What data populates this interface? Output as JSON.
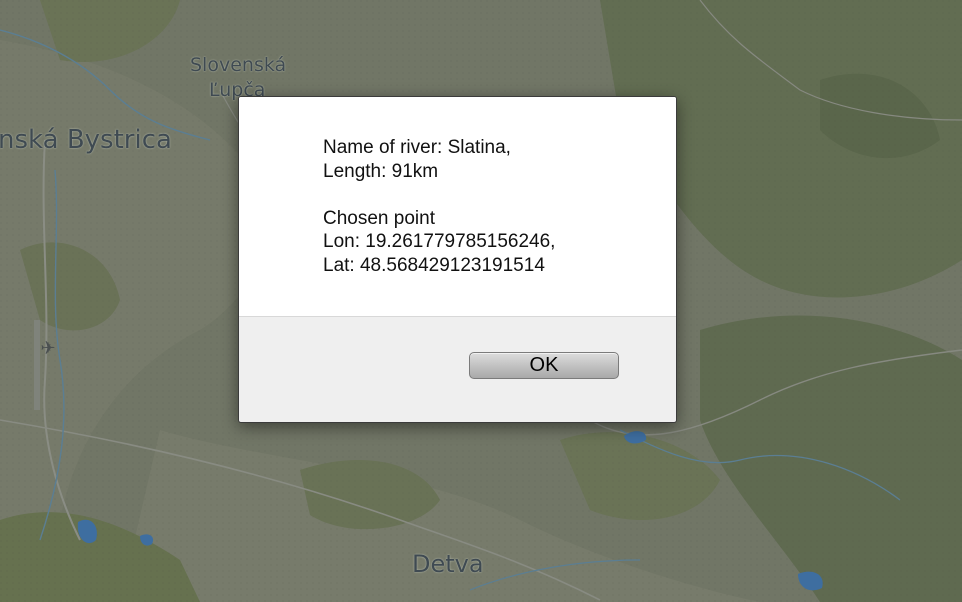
{
  "map": {
    "cities": [
      {
        "name": "nská Bystrica"
      },
      {
        "name": "Slovenská"
      },
      {
        "name": "Ľupča"
      },
      {
        "name": "Detva"
      }
    ],
    "airport_icon": "airplane-icon"
  },
  "dialog": {
    "message": {
      "river_name": "Name of river: Slatina,",
      "river_length": "Length: 91km",
      "point_title": "Chosen point",
      "lon": "Lon: 19.261779785156246,",
      "lat": "Lat: 48.568429123191514"
    },
    "ok_label": "OK"
  },
  "colors": {
    "map_base": "#6f7464",
    "forest": "#5e6c4e",
    "water": "#3e6ea0",
    "dialog_body": "#ffffff",
    "dialog_footer": "#efefef"
  }
}
